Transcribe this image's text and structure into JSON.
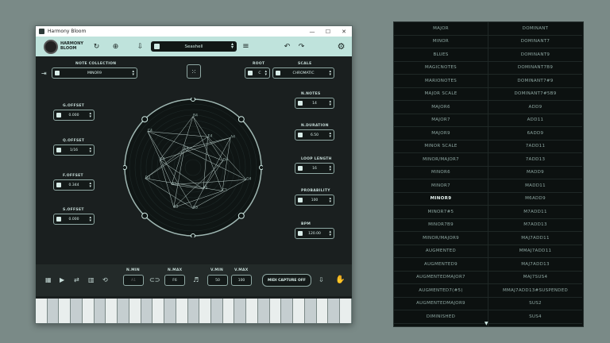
{
  "window": {
    "title": "Harmony Bloom",
    "minimize": "—",
    "maximize": "☐",
    "close": "✕"
  },
  "header": {
    "logo_line1": "HARMONY",
    "logo_line2": "BLOOM",
    "preset": "Seashell"
  },
  "note_collection": {
    "label": "NOTE COLLECTION",
    "value": "MINOR9"
  },
  "root": {
    "label": "ROOT",
    "value": "C"
  },
  "scale": {
    "label": "SCALE",
    "value": "CHROMATIC"
  },
  "left_params": [
    {
      "label": "G.OFFSET",
      "value": "0.000"
    },
    {
      "label": "Q.OFFSET",
      "value": "1/16"
    },
    {
      "label": "F.OFFSET",
      "value": "0.344"
    },
    {
      "label": "S.OFFSET",
      "value": "0.000"
    }
  ],
  "right_params": [
    {
      "label": "N.NOTES",
      "value": "14"
    },
    {
      "label": "N.DURATION",
      "value": "6.50"
    },
    {
      "label": "LOOP LENGTH",
      "value": "16"
    },
    {
      "label": "PROBABILITY",
      "value": "100"
    },
    {
      "label": "BPM",
      "value": "120.00"
    }
  ],
  "circle_notes": [
    "B4",
    "E4",
    "A4",
    "D4",
    "G4",
    "C5",
    "F5",
    "B3",
    "E3",
    "A3",
    "D3",
    "G3",
    "C4",
    "F4"
  ],
  "bottom": {
    "n_min": {
      "label": "N.MIN",
      "value": "A1"
    },
    "n_max": {
      "label": "N.MAX",
      "value": "F6"
    },
    "v_min": {
      "label": "V.MIN",
      "value": "50"
    },
    "v_max": {
      "label": "V.MAX",
      "value": "100"
    },
    "midi_capture": "MIDI CAPTURE OFF"
  },
  "chord_list": {
    "left": [
      "MAJOR",
      "MINOR",
      "BLUES",
      "MAGICNOTES",
      "MARIONOTES",
      "MAJOR SCALE",
      "MAJOR6",
      "MAJOR7",
      "MAJOR9",
      "MINOR SCALE",
      "MINOR/MAJOR7",
      "MINOR6",
      "MINOR7",
      "MINOR9",
      "MINOR7#5",
      "MINOR7B9",
      "MINOR/MAJOR9",
      "AUGMENTED",
      "AUGMENTED9",
      "AUGMENTEDMAJOR7",
      "AUGMENTED7(#5)",
      "AUGMENTEDMAJOR9",
      "DIMINISHED"
    ],
    "right": [
      "DOMINANT",
      "DOMINANT7",
      "DOMINANT9",
      "DOMINANT7B9",
      "DOMINANT7#9",
      "DOMINANT7#5B9",
      "ADD9",
      "ADD11",
      "6ADD9",
      "7ADD11",
      "7ADD13",
      "MADD9",
      "MADD11",
      "M6ADD9",
      "M7ADD11",
      "M7ADD13",
      "MAJ7ADD11",
      "MMAJ7ADD11",
      "MAJ7ADD13",
      "MAJ7SUS4",
      "MMAJ7ADD13#SUSPENDED",
      "SUS2",
      "SUS4"
    ],
    "selected": "MINOR9"
  }
}
